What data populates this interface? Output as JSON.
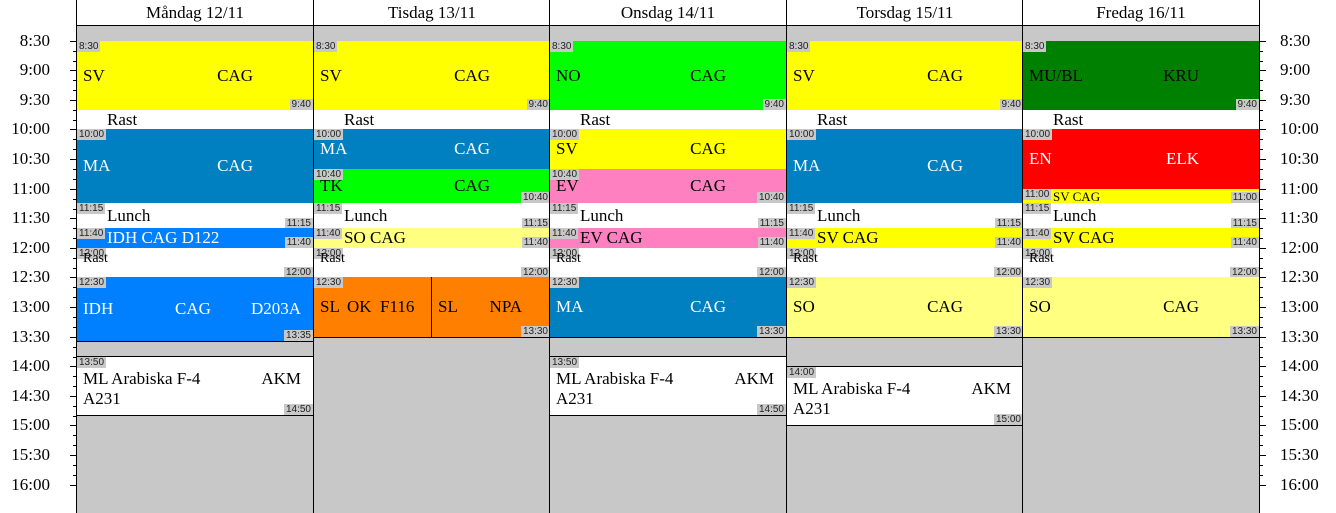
{
  "axis_labels": [
    "8:30",
    "9:00",
    "9:30",
    "10:00",
    "10:30",
    "11:00",
    "11:30",
    "12:00",
    "12:30",
    "13:00",
    "13:30",
    "14:00",
    "14:30",
    "15:00",
    "15:30",
    "16:00"
  ],
  "colors": {
    "background": "#c8c8c8",
    "yellow": "#ffff00",
    "green": "#00ff00",
    "blue": "#0080c0",
    "teal": "#0080c0",
    "pink": "#ff80c0",
    "orange": "#ff8000",
    "lightyellow": "#ffff80",
    "red": "#ff0000",
    "darkgreen": "#008000",
    "brightblue": "#0080ff",
    "white": "#ffffff"
  },
  "days": [
    {
      "name": "Måndag 12/11",
      "blocks": [
        {
          "start": "8:30",
          "end": "9:40",
          "color": "#ffff00",
          "start_label": "8:30",
          "end_label": "9:40",
          "texts": [
            "SV",
            "CAG"
          ]
        },
        {
          "start": "9:40",
          "end": "10:00",
          "color": "#ffffff",
          "texts": [
            "Rast"
          ],
          "type": "break"
        },
        {
          "start": "10:00",
          "end": "11:15",
          "color": "#0080c0",
          "start_label": "10:00",
          "end_label": "",
          "light": true,
          "texts": [
            "MA",
            "CAG"
          ]
        },
        {
          "start": "11:15",
          "end": "11:40",
          "color": "#ffffff",
          "start_label": "11:15",
          "end_label": "11:15",
          "texts": [
            "Lunch"
          ],
          "type": "break"
        },
        {
          "start": "11:40",
          "end": "12:00",
          "color": "#0080ff",
          "start_label": "11:40",
          "end_label": "11:40",
          "light": true,
          "texts": [
            "IDH CAG D122"
          ],
          "type": "short"
        },
        {
          "start": "12:00",
          "end": "12:30",
          "color": "#ffffff",
          "start_label": "12:00",
          "end_label": "12:00",
          "texts": [
            "Rast"
          ],
          "type": "break"
        },
        {
          "start": "12:30",
          "end": "13:35",
          "color": "#0080ff",
          "start_label": "12:30",
          "end_label": "13:35",
          "light": true,
          "texts": [
            "IDH",
            "CAG",
            "D203A"
          ]
        },
        {
          "start": "13:50",
          "end": "14:50",
          "color": "#ffffff",
          "start_label": "13:50",
          "end_label": "14:50",
          "texts": [
            "ML Arabiska F-4",
            "AKM",
            "A231"
          ],
          "type": "ml"
        }
      ]
    },
    {
      "name": "Tisdag 13/11",
      "blocks": [
        {
          "start": "8:30",
          "end": "9:40",
          "color": "#ffff00",
          "start_label": "8:30",
          "end_label": "9:40",
          "texts": [
            "SV",
            "CAG"
          ]
        },
        {
          "start": "9:40",
          "end": "10:00",
          "color": "#ffffff",
          "texts": [
            "Rast"
          ],
          "type": "break"
        },
        {
          "start": "10:00",
          "end": "10:40",
          "color": "#0080c0",
          "start_label": "10:00",
          "end_label": "",
          "light": true,
          "texts": [
            "MA",
            "CAG"
          ]
        },
        {
          "start": "10:40",
          "end": "11:15",
          "color": "#00ff00",
          "start_label": "10:40",
          "end_label": "10:40",
          "texts": [
            "TK",
            "CAG"
          ]
        },
        {
          "start": "11:15",
          "end": "11:40",
          "color": "#ffffff",
          "start_label": "11:15",
          "end_label": "11:15",
          "texts": [
            "Lunch"
          ],
          "type": "break"
        },
        {
          "start": "11:40",
          "end": "12:00",
          "color": "#ffff80",
          "start_label": "11:40",
          "end_label": "11:40",
          "texts": [
            "SO CAG"
          ],
          "type": "short"
        },
        {
          "start": "12:00",
          "end": "12:30",
          "color": "#ffffff",
          "start_label": "12:00",
          "end_label": "12:00",
          "texts": [
            "Rast"
          ],
          "type": "break"
        },
        {
          "start": "12:30",
          "end": "13:30",
          "color": "#ff8000",
          "start_label": "12:30",
          "end_label": "13:30",
          "texts": [
            "SL",
            "OK",
            "F116",
            "SL",
            "NPA"
          ],
          "type": "split"
        }
      ]
    },
    {
      "name": "Onsdag 14/11",
      "blocks": [
        {
          "start": "8:30",
          "end": "9:40",
          "color": "#00ff00",
          "start_label": "8:30",
          "end_label": "9:40",
          "texts": [
            "NO",
            "CAG"
          ]
        },
        {
          "start": "9:40",
          "end": "10:00",
          "color": "#ffffff",
          "texts": [
            "Rast"
          ],
          "type": "break"
        },
        {
          "start": "10:00",
          "end": "10:40",
          "color": "#ffff00",
          "start_label": "10:00",
          "end_label": "",
          "texts": [
            "SV",
            "CAG"
          ]
        },
        {
          "start": "10:40",
          "end": "11:15",
          "color": "#ff80c0",
          "start_label": "10:40",
          "end_label": "10:40",
          "texts": [
            "EV",
            "CAG"
          ]
        },
        {
          "start": "11:15",
          "end": "11:40",
          "color": "#ffffff",
          "start_label": "11:15",
          "end_label": "11:15",
          "texts": [
            "Lunch"
          ],
          "type": "break"
        },
        {
          "start": "11:40",
          "end": "12:00",
          "color": "#ff80c0",
          "start_label": "11:40",
          "end_label": "11:40",
          "texts": [
            "EV CAG"
          ],
          "type": "short"
        },
        {
          "start": "12:00",
          "end": "12:30",
          "color": "#ffffff",
          "start_label": "12:00",
          "end_label": "12:00",
          "texts": [
            "Rast"
          ],
          "type": "break"
        },
        {
          "start": "12:30",
          "end": "13:30",
          "color": "#0080c0",
          "start_label": "12:30",
          "end_label": "13:30",
          "light": true,
          "texts": [
            "MA",
            "CAG"
          ]
        },
        {
          "start": "13:50",
          "end": "14:50",
          "color": "#ffffff",
          "start_label": "13:50",
          "end_label": "14:50",
          "texts": [
            "ML Arabiska F-4",
            "AKM",
            "A231"
          ],
          "type": "ml"
        }
      ]
    },
    {
      "name": "Torsdag 15/11",
      "blocks": [
        {
          "start": "8:30",
          "end": "9:40",
          "color": "#ffff00",
          "start_label": "8:30",
          "end_label": "9:40",
          "texts": [
            "SV",
            "CAG"
          ]
        },
        {
          "start": "9:40",
          "end": "10:00",
          "color": "#ffffff",
          "texts": [
            "Rast"
          ],
          "type": "break"
        },
        {
          "start": "10:00",
          "end": "11:15",
          "color": "#0080c0",
          "start_label": "10:00",
          "end_label": "",
          "light": true,
          "texts": [
            "MA",
            "CAG"
          ]
        },
        {
          "start": "11:15",
          "end": "11:40",
          "color": "#ffffff",
          "start_label": "11:15",
          "end_label": "11:15",
          "texts": [
            "Lunch"
          ],
          "type": "break"
        },
        {
          "start": "11:40",
          "end": "12:00",
          "color": "#ffff00",
          "start_label": "11:40",
          "end_label": "11:40",
          "texts": [
            "SV CAG"
          ],
          "type": "short"
        },
        {
          "start": "12:00",
          "end": "12:30",
          "color": "#ffffff",
          "start_label": "12:00",
          "end_label": "12:00",
          "texts": [
            "Rast"
          ],
          "type": "break"
        },
        {
          "start": "12:30",
          "end": "13:30",
          "color": "#ffff80",
          "start_label": "12:30",
          "end_label": "13:30",
          "texts": [
            "SO",
            "CAG"
          ]
        },
        {
          "start": "14:00",
          "end": "15:00",
          "color": "#ffffff",
          "start_label": "14:00",
          "end_label": "15:00",
          "texts": [
            "ML Arabiska F-4",
            "AKM",
            "A231"
          ],
          "type": "ml"
        }
      ]
    },
    {
      "name": "Fredag 16/11",
      "blocks": [
        {
          "start": "8:30",
          "end": "9:40",
          "color": "#008000",
          "start_label": "8:30",
          "end_label": "9:40",
          "texts": [
            "MU/BL",
            "KRU"
          ]
        },
        {
          "start": "9:40",
          "end": "10:00",
          "color": "#ffffff",
          "texts": [
            "Rast"
          ],
          "type": "break"
        },
        {
          "start": "10:00",
          "end": "11:00",
          "color": "#ff0000",
          "start_label": "10:00",
          "end_label": "",
          "light": true,
          "texts": [
            "EN",
            "ELK"
          ]
        },
        {
          "start": "11:00",
          "end": "11:15",
          "color": "#ffff00",
          "start_label": "11:00",
          "end_label": "11:00",
          "texts": [
            "SV CAG"
          ],
          "type": "tiny"
        },
        {
          "start": "11:15",
          "end": "11:40",
          "color": "#ffffff",
          "start_label": "11:15",
          "end_label": "11:15",
          "texts": [
            "Lunch"
          ],
          "type": "break"
        },
        {
          "start": "11:40",
          "end": "12:00",
          "color": "#ffff00",
          "start_label": "11:40",
          "end_label": "11:40",
          "texts": [
            "SV CAG"
          ],
          "type": "short"
        },
        {
          "start": "12:00",
          "end": "12:30",
          "color": "#ffffff",
          "start_label": "12:00",
          "end_label": "12:00",
          "texts": [
            "Rast"
          ],
          "type": "break"
        },
        {
          "start": "12:30",
          "end": "13:30",
          "color": "#ffff80",
          "start_label": "12:30",
          "end_label": "13:30",
          "texts": [
            "SO",
            "CAG"
          ]
        }
      ]
    }
  ]
}
